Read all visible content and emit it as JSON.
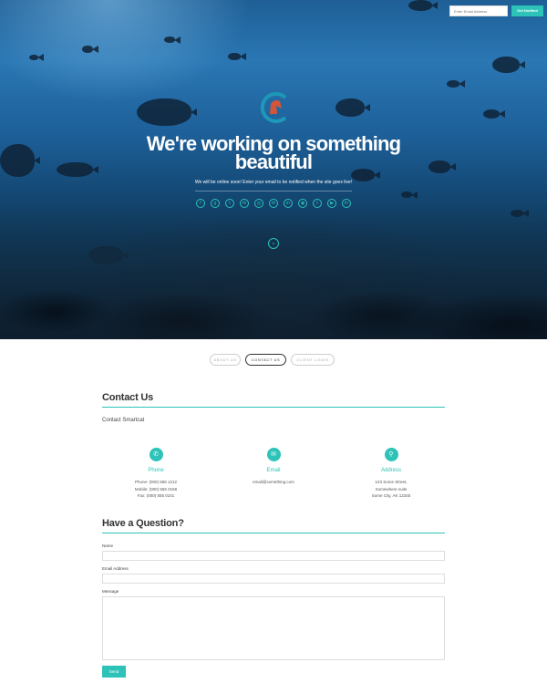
{
  "notify": {
    "placeholder": "Enter Email Address",
    "button_label": "Get Notified"
  },
  "hero": {
    "title_line1": "We're working on something",
    "title_line2": "beautiful",
    "subtitle": "We will be online soon! Enter your email to be notified when the site goes live!",
    "social_icons": [
      "facebook-icon",
      "google-plus-icon",
      "twitter-icon",
      "email-icon",
      "instagram-icon",
      "mail-icon",
      "linkedin-icon",
      "dribbble-icon",
      "tumblr-icon",
      "youtube-icon",
      "linkedin-in-icon"
    ],
    "social_glyphs": [
      "f",
      "g",
      "t",
      "✉",
      "◎",
      "✉",
      "in",
      "◉",
      "t",
      "▶",
      "in"
    ]
  },
  "tabs": [
    {
      "label": "ABOUT US"
    },
    {
      "label": "CONTACT US"
    },
    {
      "label": "CLIENT LOGIN"
    }
  ],
  "contact": {
    "heading": "Contact Us",
    "subheading": "Contact Smartcat",
    "columns": [
      {
        "title": "Phone",
        "icon": "phone-icon",
        "glyph": "✆",
        "lines": [
          "Phone: (000) 555 1212",
          "Mobile: (000) 555 0158",
          "Fax: (000) 555 0101"
        ]
      },
      {
        "title": "Email",
        "icon": "email-icon",
        "glyph": "✉",
        "lines": [
          "email@something.com"
        ]
      },
      {
        "title": "Address",
        "icon": "location-pin-icon",
        "glyph": "⚲",
        "lines": [
          "123 Some Street,",
          "Somewhere suite",
          "Some City, AK 12345"
        ]
      }
    ]
  },
  "question": {
    "heading": "Have a Question?",
    "name_label": "Name",
    "email_label": "Email Address",
    "message_label": "Message",
    "send_label": "Send"
  },
  "colors": {
    "accent": "#2dc3b8"
  }
}
